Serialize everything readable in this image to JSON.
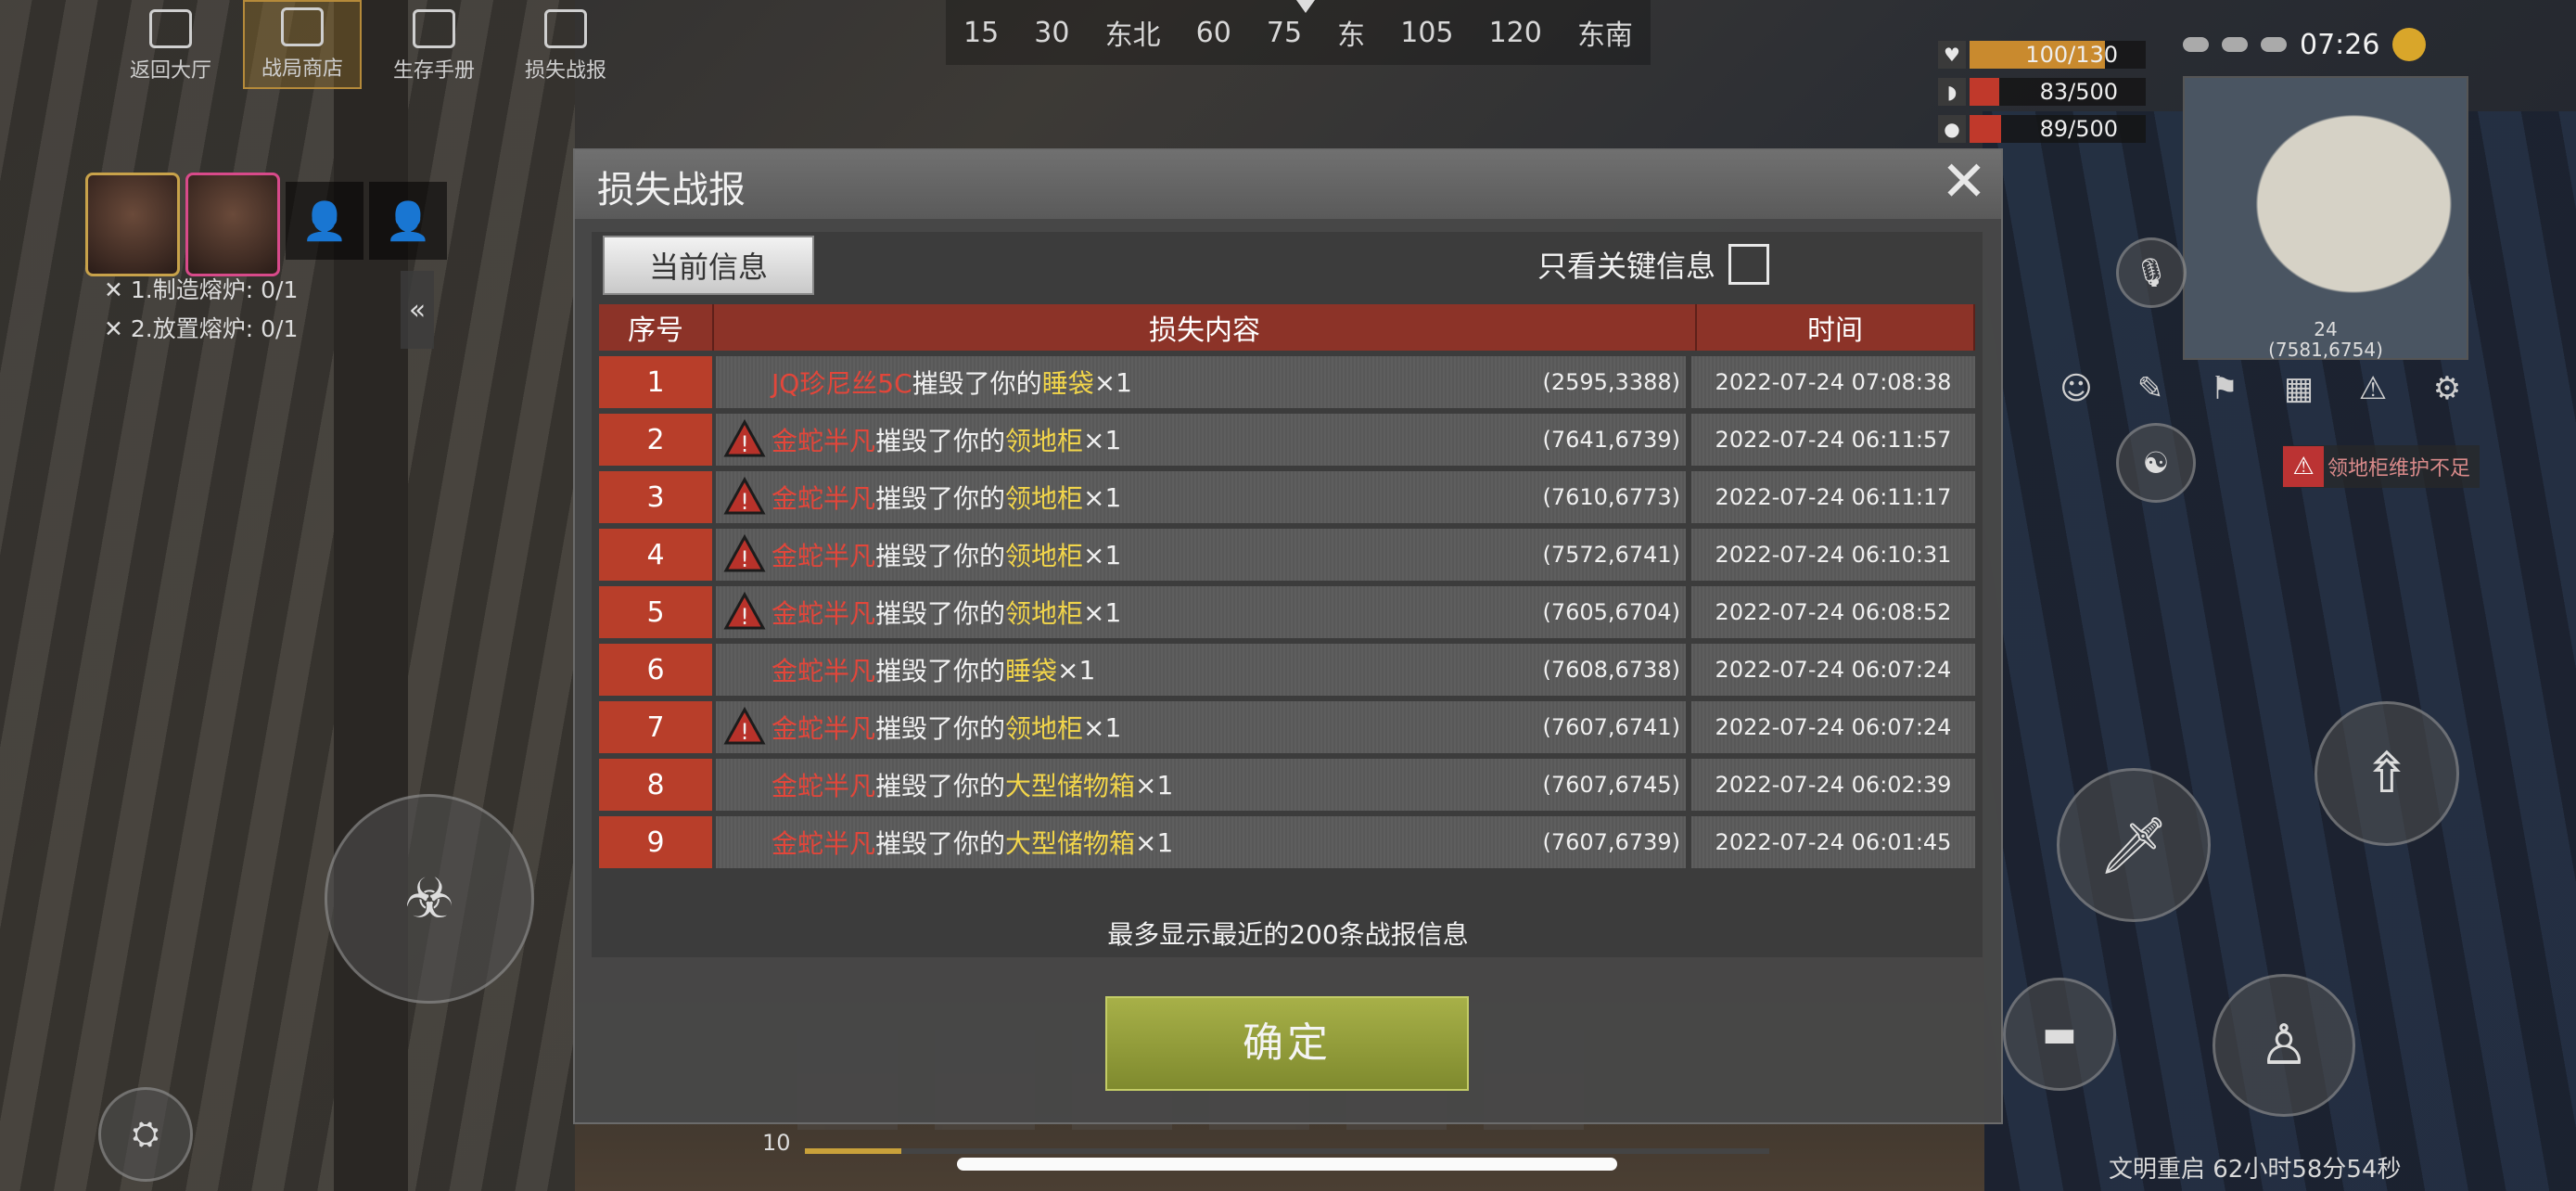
{
  "compass": {
    "ticks": [
      "15",
      "30",
      "东北",
      "60",
      "75",
      "东",
      "105",
      "120",
      "东南"
    ]
  },
  "top_menu": [
    {
      "label": "返回大厅",
      "icon": "home-icon"
    },
    {
      "label": "战局商店",
      "icon": "shop-icon"
    },
    {
      "label": "生存手册",
      "icon": "book-icon"
    },
    {
      "label": "损失战报",
      "icon": "report-icon"
    }
  ],
  "tasks": [
    "1.制造熔炉: 0/1",
    "2.放置熔炉: 0/1"
  ],
  "stats": {
    "health": {
      "text": "100/130",
      "value": 100,
      "max": 130,
      "color": "#c98a2e"
    },
    "food": {
      "text": "83/500",
      "value": 83,
      "max": 500,
      "color": "#c0392b"
    },
    "water": {
      "text": "89/500",
      "value": 89,
      "max": 500,
      "color": "#c0392b"
    }
  },
  "clock": "07:26",
  "minimap": {
    "grid": "24",
    "position": "(7581,6754)"
  },
  "territory_warning": "领地柜维护不足",
  "modal": {
    "title": "损失战报",
    "tab_current": "当前信息",
    "key_only_label": "只看关键信息",
    "key_only_checked": false,
    "columns": {
      "no": "序号",
      "content": "损失内容",
      "time": "时间"
    },
    "rows": [
      {
        "no": "1",
        "warn": false,
        "killer": "JQ珍尼丝5C",
        "verb": "摧毁了你的",
        "item": "睡袋",
        "qty": "×1",
        "coords": "(2595,3388)",
        "time": "2022-07-24 07:08:38"
      },
      {
        "no": "2",
        "warn": true,
        "killer": "金蛇半凡",
        "verb": "摧毁了你的",
        "item": "领地柜",
        "qty": "×1",
        "coords": "(7641,6739)",
        "time": "2022-07-24 06:11:57"
      },
      {
        "no": "3",
        "warn": true,
        "killer": "金蛇半凡",
        "verb": "摧毁了你的",
        "item": "领地柜",
        "qty": "×1",
        "coords": "(7610,6773)",
        "time": "2022-07-24 06:11:17"
      },
      {
        "no": "4",
        "warn": true,
        "killer": "金蛇半凡",
        "verb": "摧毁了你的",
        "item": "领地柜",
        "qty": "×1",
        "coords": "(7572,6741)",
        "time": "2022-07-24 06:10:31"
      },
      {
        "no": "5",
        "warn": true,
        "killer": "金蛇半凡",
        "verb": "摧毁了你的",
        "item": "领地柜",
        "qty": "×1",
        "coords": "(7605,6704)",
        "time": "2022-07-24 06:08:52"
      },
      {
        "no": "6",
        "warn": false,
        "killer": "金蛇半凡",
        "verb": "摧毁了你的",
        "item": "睡袋",
        "qty": "×1",
        "coords": "(7608,6738)",
        "time": "2022-07-24 06:07:24"
      },
      {
        "no": "7",
        "warn": true,
        "killer": "金蛇半凡",
        "verb": "摧毁了你的",
        "item": "领地柜",
        "qty": "×1",
        "coords": "(7607,6741)",
        "time": "2022-07-24 06:07:24"
      },
      {
        "no": "8",
        "warn": false,
        "killer": "金蛇半凡",
        "verb": "摧毁了你的",
        "item": "大型储物箱",
        "qty": "×1",
        "coords": "(7607,6745)",
        "time": "2022-07-24 06:02:39"
      },
      {
        "no": "9",
        "warn": false,
        "killer": "金蛇半凡",
        "verb": "摧毁了你的",
        "item": "大型储物箱",
        "qty": "×1",
        "coords": "(7607,6739)",
        "time": "2022-07-24 06:01:45"
      }
    ],
    "footnote": "最多显示最近的200条战报信息",
    "confirm_label": "确定"
  },
  "hotbar_level": "10",
  "hotbar_progress": 0.1,
  "civilization_countdown": "文明重启 62小时58分54秒",
  "colors": {
    "killer": "#e2463a",
    "item": "#f2d54a",
    "row_number_bg": "#b83e2a",
    "header_bg": "#8c3328",
    "confirm_bg": "#a7b048"
  }
}
